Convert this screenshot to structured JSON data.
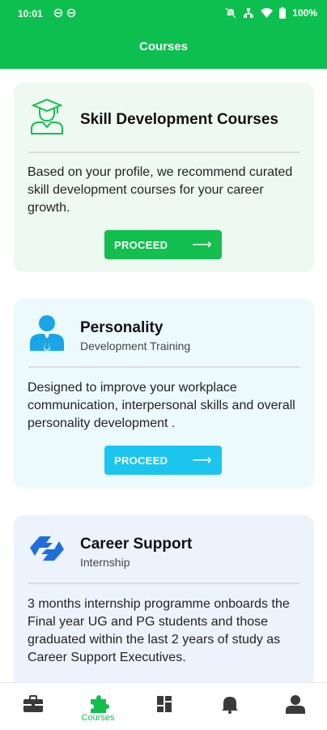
{
  "status_bar": {
    "time": "10:01",
    "battery": "100%"
  },
  "header": {
    "title": "Courses"
  },
  "cards": [
    {
      "title": "Skill Development Courses",
      "subtitle": "",
      "description": "Based on your profile, we recommend curated skill development courses for your career growth.",
      "button_label": "PROCEED",
      "icon": "graduate-icon",
      "accent": "#12bf4f"
    },
    {
      "title": "Personality",
      "subtitle": "Development Training",
      "description": "Designed to improve your workplace communication, interpersonal skills and overall personality development .",
      "button_label": "PROCEED",
      "icon": "person-tie-icon",
      "accent": "#1cc5ee"
    },
    {
      "title": "Career Support",
      "subtitle": "Internship",
      "description": "3 months internship programme onboards the Final year UG and PG students and those graduated within the last 2 years of study as Career Support Executives.",
      "icon": "handshake-icon",
      "accent": "#1e6fd9"
    }
  ],
  "bottom_nav": {
    "items": [
      {
        "icon": "briefcase-icon",
        "label": ""
      },
      {
        "icon": "puzzle-icon",
        "label": "Courses",
        "active": true
      },
      {
        "icon": "dashboard-icon",
        "label": ""
      },
      {
        "icon": "bell-icon",
        "label": ""
      },
      {
        "icon": "profile-icon",
        "label": ""
      }
    ],
    "active_color": "#12bf4f",
    "inactive_color": "#3a3a3a"
  }
}
